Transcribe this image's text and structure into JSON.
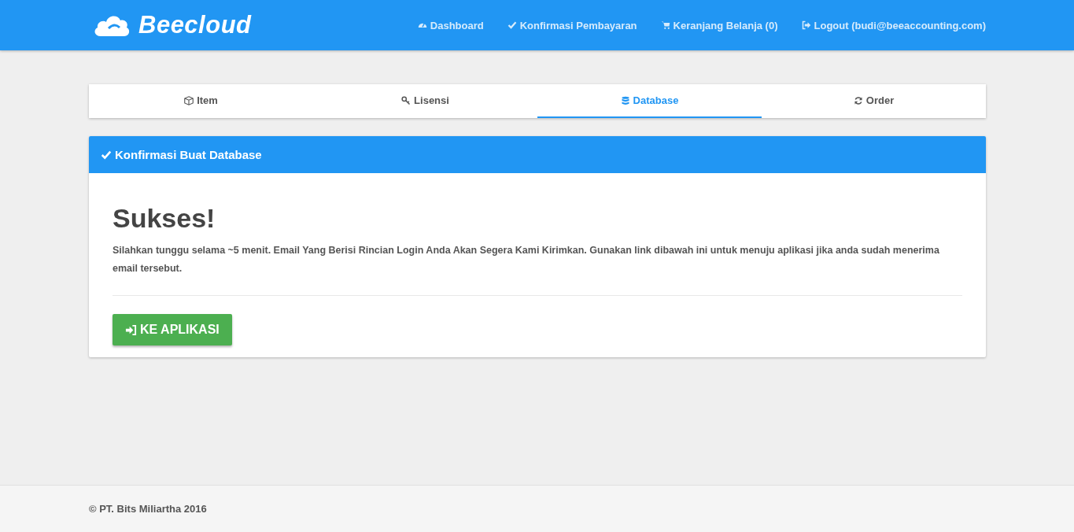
{
  "brand": {
    "name": "Beecloud"
  },
  "nav": [
    {
      "kind": "dashboard",
      "label": "Dashboard"
    },
    {
      "kind": "check",
      "label": "Konfirmasi Pembayaran"
    },
    {
      "kind": "cart",
      "label": "Keranjang Belanja (0)"
    },
    {
      "kind": "logout",
      "label": "Logout (budi@beeaccounting.com)"
    }
  ],
  "tabs": [
    {
      "kind": "cube",
      "label": "Item",
      "selected": false
    },
    {
      "kind": "key",
      "label": "Lisensi",
      "selected": false
    },
    {
      "kind": "database",
      "label": "Database",
      "selected": true
    },
    {
      "kind": "refresh",
      "label": "Order",
      "selected": false
    }
  ],
  "panel": {
    "title": "Konfirmasi Buat Database",
    "heading": "Sukses!",
    "message": "Silahkan tunggu selama ~5 menit. Email Yang Berisi Rincian Login Anda Akan Segera Kami Kirimkan. Gunakan link dibawah ini untuk menuju aplikasi jika anda sudah menerima email tersebut.",
    "button": "KE APLIKASI"
  },
  "footer": {
    "text": "© PT. Bits Miliartha 2016"
  }
}
